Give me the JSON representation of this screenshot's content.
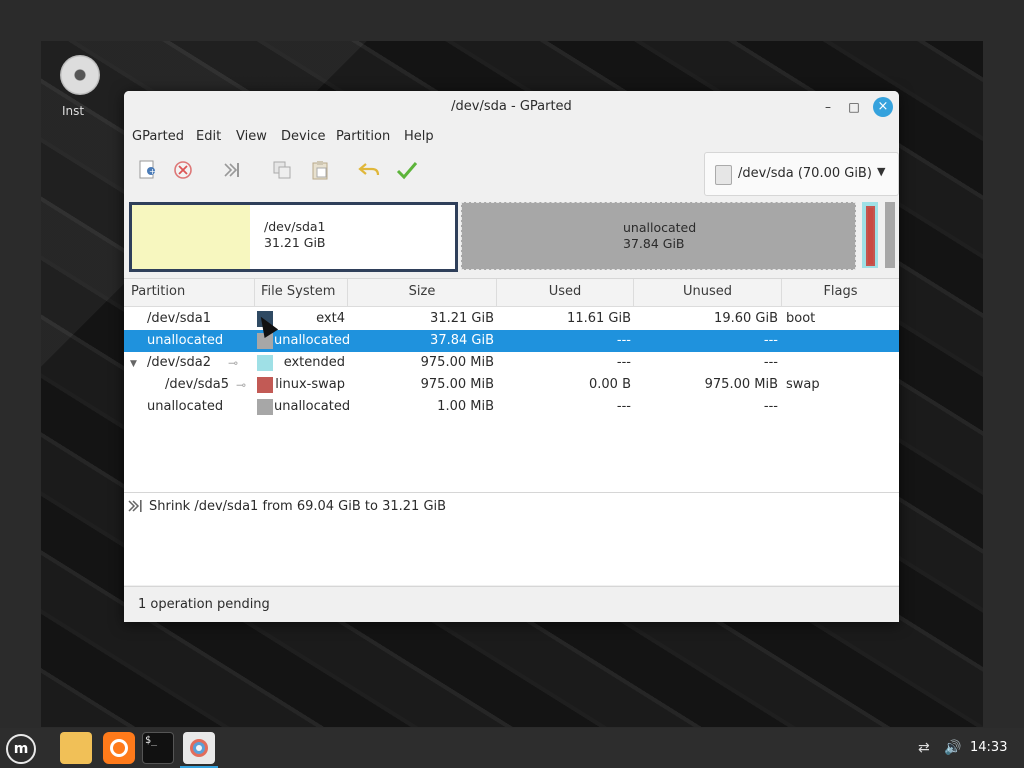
{
  "desktop": {
    "icon_label": "Inst"
  },
  "window": {
    "title": "/dev/sda - GParted",
    "buttons": {
      "min": "–",
      "max": "□",
      "close": "×"
    }
  },
  "menubar": [
    "GParted",
    "Edit",
    "View",
    "Device",
    "Partition",
    "Help"
  ],
  "toolbar": {
    "icons": [
      "new-icon",
      "delete-icon",
      "resize-move-icon",
      "copy-icon",
      "paste-icon",
      "undo-icon",
      "apply-icon"
    ]
  },
  "device": {
    "label": "/dev/sda  (70.00 GiB)"
  },
  "diskmap": {
    "seg1_name": "/dev/sda1",
    "seg1_size": "31.21 GiB",
    "seg2_name": "unallocated",
    "seg2_size": "37.84 GiB"
  },
  "table": {
    "headers": [
      "Partition",
      "File System",
      "Size",
      "Used",
      "Unused",
      "Flags"
    ],
    "rows": [
      {
        "partition": "/dev/sda1",
        "fs": "ext4",
        "size": "31.21 GiB",
        "used": "11.61 GiB",
        "unused": "19.60 GiB",
        "flags": "boot",
        "color": "#2f4a63"
      },
      {
        "partition": "unallocated",
        "fs": "unallocated",
        "size": "37.84 GiB",
        "used": "---",
        "unused": "---",
        "flags": "",
        "color": "#a7a7a7"
      },
      {
        "partition": "/dev/sda2",
        "fs": "extended",
        "size": "975.00 MiB",
        "used": "---",
        "unused": "---",
        "flags": "",
        "color": "#9fe0e6"
      },
      {
        "partition": "/dev/sda5",
        "fs": "linux-swap",
        "size": "975.00 MiB",
        "used": "0.00 B",
        "unused": "975.00 MiB",
        "flags": "swap",
        "color": "#c25a55"
      },
      {
        "partition": "unallocated",
        "fs": "unallocated",
        "size": "1.00 MiB",
        "used": "---",
        "unused": "---",
        "flags": "",
        "color": "#a7a7a7"
      }
    ]
  },
  "operations": [
    "Shrink /dev/sda1 from 69.04 GiB to 31.21 GiB"
  ],
  "status": "1 operation pending",
  "taskbar": {
    "clock": "14:33"
  }
}
